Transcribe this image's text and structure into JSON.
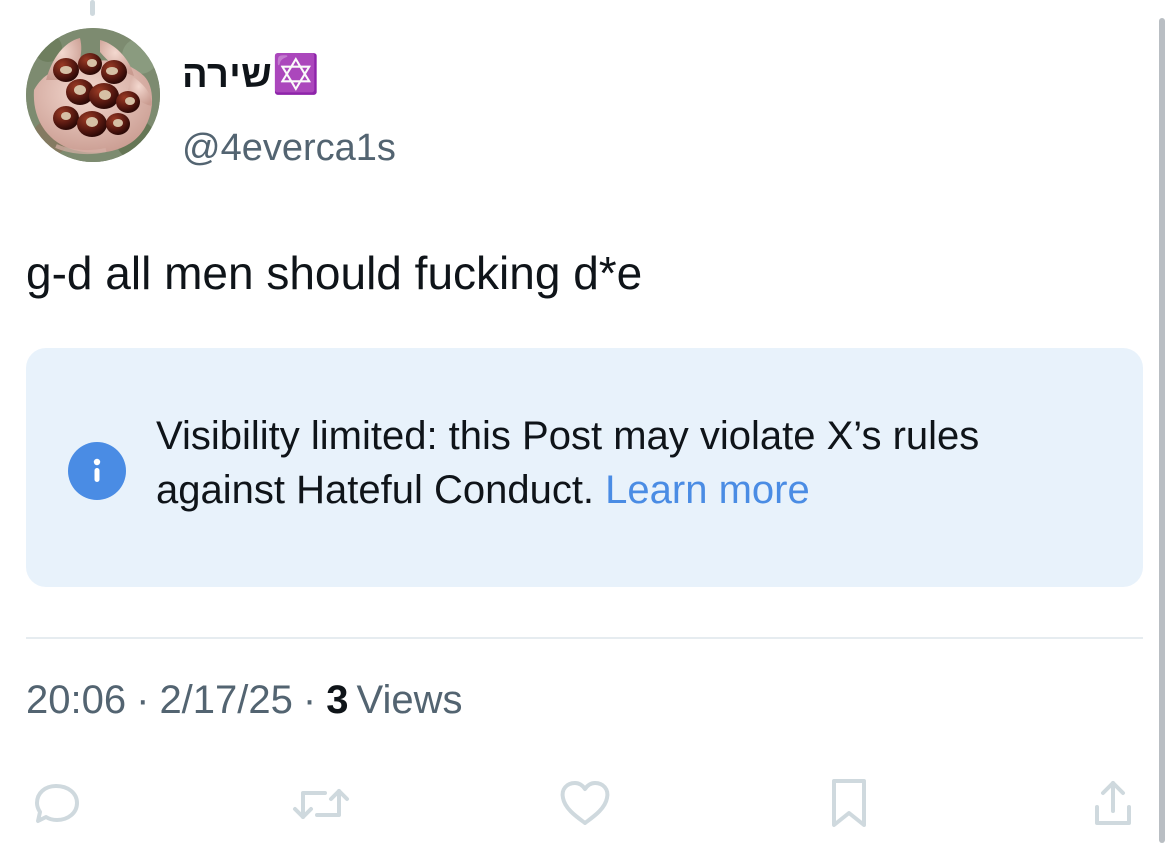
{
  "post": {
    "author": {
      "display_name": "✡️שירה",
      "handle": "@4everca1s"
    },
    "text": "g-d all men should fucking d*e",
    "notice": {
      "message": "Visibility limited: this Post may violate X’s rules against Hateful Conduct.",
      "link_label": "Learn more",
      "icon": "info-icon"
    },
    "meta": {
      "time": "20:06",
      "separator": "·",
      "date": "2/17/25",
      "views_count": "3",
      "views_label": "Views"
    },
    "actions": {
      "reply_icon": "reply-icon",
      "repost_icon": "repost-icon",
      "like_icon": "like-icon",
      "bookmark_icon": "bookmark-icon",
      "share_icon": "share-icon"
    }
  },
  "colors": {
    "text": "#0f1419",
    "muted": "#536471",
    "accent": "#4a8ce4",
    "notice_background": "#e8f2fb",
    "divider": "#e6ecf0"
  }
}
